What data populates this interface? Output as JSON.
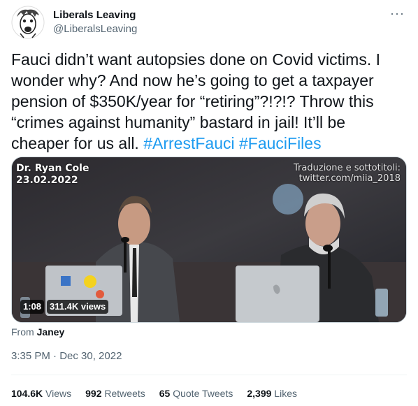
{
  "author": {
    "display_name": "Liberals Leaving",
    "handle": "@LiberalsLeaving",
    "avatar_icon": "caricature-avatar-icon"
  },
  "more_icon": "more-options-icon",
  "tweet_text": {
    "body": "Fauci didn’t want autopsies done on Covid victims. I wonder why? And now he’s going to get a taxpayer pension of $350K/year for “retiring”?!?!? Throw this “crimes against humanity” bastard in jail! It’ll be cheaper for us all.",
    "hashtags": [
      "#ArrestFauci",
      "#FauciFiles"
    ]
  },
  "media": {
    "overlay_name": "Dr. Ryan Cole",
    "overlay_date": "23.02.2022",
    "overlay_credit_line1": "Traduzione e sottotitoli:",
    "overlay_credit_line2": "twitter.com/miia_2018",
    "duration": "1:08",
    "views": "311.4K views"
  },
  "source": {
    "prefix": "From",
    "name": "Janey"
  },
  "timestamp": "3:35 PM · Dec 30, 2022",
  "stats": {
    "views_count": "104.6K",
    "views_label": "Views",
    "retweets_count": "992",
    "retweets_label": "Retweets",
    "quotes_count": "65",
    "quotes_label": "Quote Tweets",
    "likes_count": "2,399",
    "likes_label": "Likes"
  },
  "colors": {
    "link": "#1d9bf0",
    "text": "#0f1419",
    "secondary": "#536471"
  }
}
